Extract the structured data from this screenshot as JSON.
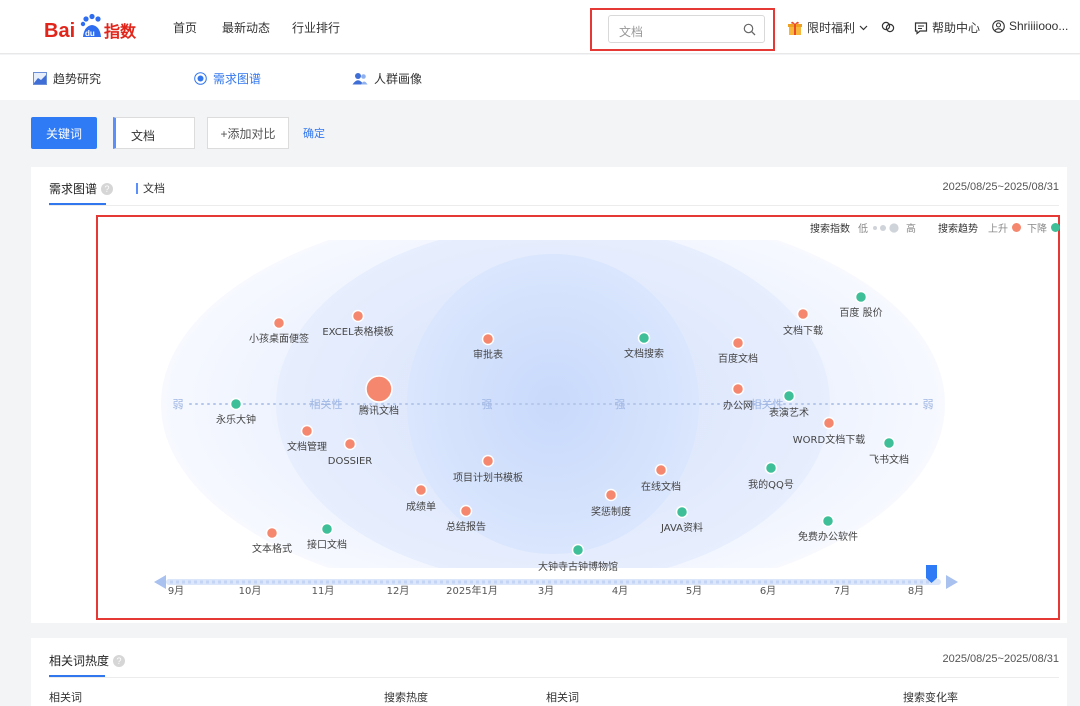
{
  "header": {
    "logo_text": "Baidu指数",
    "nav": [
      "首页",
      "最新动态",
      "行业排行"
    ],
    "search": {
      "placeholder": "文档"
    },
    "promo_label": "限时福利",
    "help_label": "帮助中心",
    "user_label": "Shriiiiooo..."
  },
  "subnav": {
    "items": [
      {
        "label": "趋势研究",
        "icon": "trend-chart-icon"
      },
      {
        "label": "需求图谱",
        "icon": "radar-icon"
      },
      {
        "label": "人群画像",
        "icon": "users-icon"
      }
    ],
    "active_index": 1
  },
  "keyword_bar": {
    "keyword_button": "关键词",
    "keyword_value": "文档",
    "add_compare": "+添加对比",
    "confirm": "确定"
  },
  "demand_map": {
    "title": "需求图谱",
    "series_tag": "文档",
    "date_range": "2025/08/25~2025/08/31",
    "legend": {
      "index_label": "搜索指数",
      "low": "低",
      "high": "高",
      "trend_label": "搜索趋势",
      "up": "上升",
      "down": "下降"
    },
    "axis_labels": [
      "弱",
      "相关性",
      "强",
      "强",
      "相关性",
      "弱"
    ],
    "center_keyword": "腾讯文档",
    "colors": {
      "up": "#f5876e",
      "down": "#3ebf98",
      "accent": "#3377ee",
      "frame": "#e53935"
    },
    "keywords": [
      {
        "name": "小孩桌面便签",
        "trend": "up"
      },
      {
        "name": "EXCEL表格模板",
        "trend": "up"
      },
      {
        "name": "审批表",
        "trend": "up"
      },
      {
        "name": "文档搜索",
        "trend": "down"
      },
      {
        "name": "百度文档",
        "trend": "up"
      },
      {
        "name": "文档下载",
        "trend": "up"
      },
      {
        "name": "百度 股价",
        "trend": "down"
      },
      {
        "name": "永乐大钟",
        "trend": "down"
      },
      {
        "name": "腾讯文档",
        "trend": "up"
      },
      {
        "name": "办公网",
        "trend": "up"
      },
      {
        "name": "表演艺术",
        "trend": "down"
      },
      {
        "name": "文档管理",
        "trend": "up"
      },
      {
        "name": "DOSSIER",
        "trend": "up"
      },
      {
        "name": "WORD文档下载",
        "trend": "up"
      },
      {
        "name": "飞书文档",
        "trend": "down"
      },
      {
        "name": "项目计划书模板",
        "trend": "up"
      },
      {
        "name": "在线文档",
        "trend": "up"
      },
      {
        "name": "我的QQ号",
        "trend": "down"
      },
      {
        "name": "成绩单",
        "trend": "up"
      },
      {
        "name": "奖惩制度",
        "trend": "up"
      },
      {
        "name": "总结报告",
        "trend": "up"
      },
      {
        "name": "JAVA资料",
        "trend": "down"
      },
      {
        "name": "免费办公软件",
        "trend": "down"
      },
      {
        "name": "文本格式",
        "trend": "up"
      },
      {
        "name": "接口文档",
        "trend": "down"
      },
      {
        "name": "大钟寺古钟博物馆",
        "trend": "down"
      }
    ],
    "timeline": [
      "9月",
      "10月",
      "11月",
      "12月",
      "2025年1月",
      "3月",
      "4月",
      "5月",
      "6月",
      "7月",
      "8月"
    ],
    "timeline_selected": "8月"
  },
  "related_heat": {
    "title": "相关词热度",
    "date_range": "2025/08/25~2025/08/31",
    "columns": [
      "相关词",
      "搜索热度",
      "相关词",
      "搜索变化率"
    ]
  }
}
